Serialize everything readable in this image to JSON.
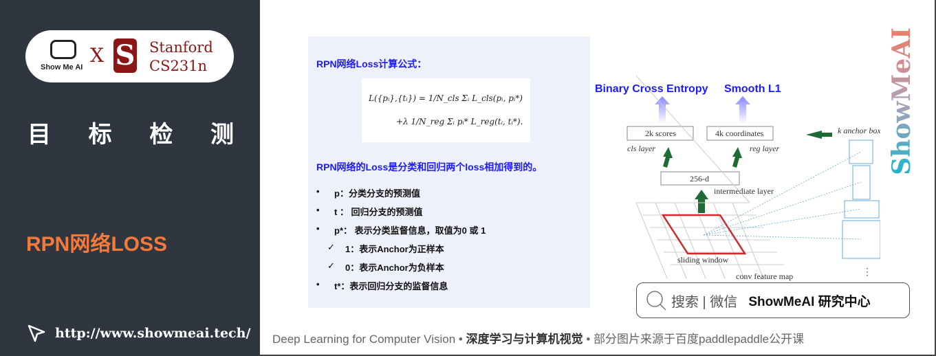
{
  "sidebar": {
    "logo": {
      "showmeai": "Show Me AI",
      "x": "X",
      "stanford_line1": "Stanford",
      "stanford_line2": "CS231n"
    },
    "title_chars": [
      "目",
      "标",
      "检",
      "测"
    ],
    "subtitle": "RPN网络LOSS",
    "url": "http://www.showmeai.tech/"
  },
  "panel": {
    "heading": "RPN网络Loss计算公式：",
    "formula_line1": "L({pᵢ},{tᵢ}) = 1/N_cls Σᵢ L_cls(pᵢ, pᵢ*)",
    "formula_line2": "+λ 1/N_reg Σᵢ pᵢ* L_reg(tᵢ, tᵢ*).",
    "summary": "RPN网络的Loss是分类和回归两个loss相加得到的。",
    "items": [
      {
        "mark": "•",
        "text": "p：分类分支的预测值"
      },
      {
        "mark": "•",
        "text": "t ： 回归分支的预测值"
      },
      {
        "mark": "•",
        "text": "p*： 表示分类监督信息，取值为0 或 1"
      },
      {
        "mark": "✓",
        "text": "1：表示Anchor为正样本"
      },
      {
        "mark": "✓",
        "text": "0：表示Anchor为负样本"
      },
      {
        "mark": "•",
        "text": "t*：表示回归分支的监督信息"
      }
    ]
  },
  "diagram": {
    "bce": "Binary Cross Entropy",
    "smooth": "Smooth L1",
    "scores": "2k scores",
    "coords": "4k coordinates",
    "cls": "cls layer",
    "reg": "reg layer",
    "d256": "256-d",
    "inter": "intermediate layer",
    "anchors": "k anchor boxes",
    "sliding": "sliding window",
    "conv": "conv feature map",
    "colors": {
      "arrow": "#1e6b35",
      "window": "#cc2a2a",
      "anchor": "#6aa8d8",
      "loss": "#1a1aff"
    }
  },
  "watermark": "ShowMeAI",
  "search": {
    "label": "搜索 | 微信",
    "brand": "ShowMeAI 研究中心"
  },
  "footer": {
    "en": "Deep Learning for Computer Vision",
    "sep": " • ",
    "cn": "深度学习与计算机视觉",
    "note": "部分图片来源于百度paddlepaddle公开课"
  }
}
